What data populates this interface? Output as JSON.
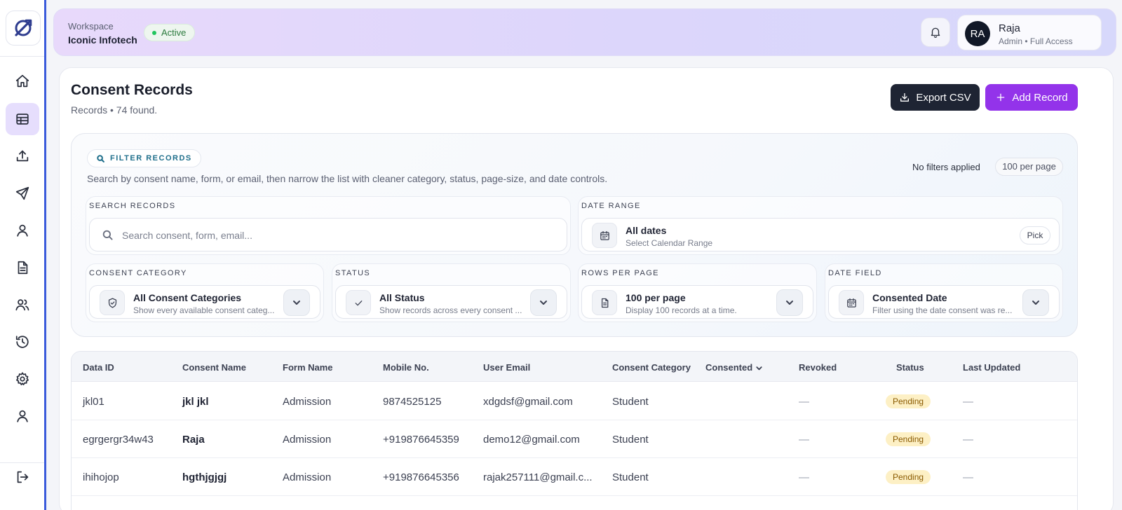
{
  "header": {
    "workspace_label": "Workspace",
    "workspace_name": "Iconic Infotech",
    "status": "Active",
    "user": {
      "initials": "RA",
      "name": "Raja",
      "role": "Admin • Full Access"
    }
  },
  "sidebar": {
    "items": [
      {
        "name": "home",
        "icon": "home-icon"
      },
      {
        "name": "records",
        "icon": "table-icon",
        "active": true
      },
      {
        "name": "upload",
        "icon": "upload-icon"
      },
      {
        "name": "send",
        "icon": "send-icon"
      },
      {
        "name": "user",
        "icon": "user-icon"
      },
      {
        "name": "document",
        "icon": "document-icon"
      },
      {
        "name": "users",
        "icon": "users-icon"
      },
      {
        "name": "history",
        "icon": "history-icon"
      },
      {
        "name": "settings",
        "icon": "gear-icon"
      },
      {
        "name": "profile",
        "icon": "user-icon"
      },
      {
        "name": "logout",
        "icon": "logout-icon"
      }
    ]
  },
  "page": {
    "title": "Consent Records",
    "subtitle": "Records • 74 found.",
    "export_label": "Export CSV",
    "add_label": "Add Record"
  },
  "filter": {
    "badge": "FILTER RECORDS",
    "description": "Search by consent name, form, or email, then narrow the list with cleaner category, status, page-size, and date controls.",
    "no_filters": "No filters applied",
    "per_page_pill": "100 per page",
    "search": {
      "label": "SEARCH RECORDS",
      "placeholder": "Search consent, form, email..."
    },
    "date_range": {
      "label": "DATE RANGE",
      "title": "All dates",
      "subtitle": "Select Calendar Range",
      "pick": "Pick"
    },
    "category": {
      "label": "CONSENT CATEGORY",
      "title": "All Consent Categories",
      "subtitle": "Show every available consent categ..."
    },
    "status": {
      "label": "STATUS",
      "title": "All Status",
      "subtitle": "Show records across every consent ..."
    },
    "rows": {
      "label": "ROWS PER PAGE",
      "title": "100 per page",
      "subtitle": "Display 100 records at a time."
    },
    "date_field": {
      "label": "DATE FIELD",
      "title": "Consented Date",
      "subtitle": "Filter using the date consent was re..."
    }
  },
  "table": {
    "columns": [
      "Data ID",
      "Consent Name",
      "Form Name",
      "Mobile No.",
      "User Email",
      "Consent Category",
      "Consented",
      "Revoked",
      "Status",
      "Last Updated"
    ],
    "rows": [
      {
        "id": "jkl01",
        "name": "jkl jkl",
        "form": "Admission",
        "mobile": "9874525125",
        "email": "xdgdsf@gmail.com",
        "category": "Student",
        "consented": "",
        "revoked": "—",
        "status": "Pending",
        "updated": "—"
      },
      {
        "id": "egrgergr34w43",
        "name": "Raja",
        "form": "Admission",
        "mobile": "+919876645359",
        "email": "demo12@gmail.com",
        "category": "Student",
        "consented": "",
        "revoked": "—",
        "status": "Pending",
        "updated": "—"
      },
      {
        "id": "ihihojop",
        "name": "hgthjgjgj",
        "form": "Admission",
        "mobile": "+919876645356",
        "email": "rajak257111@gmail.c...",
        "category": "Student",
        "consented": "",
        "revoked": "—",
        "status": "Pending",
        "updated": "—"
      }
    ]
  }
}
